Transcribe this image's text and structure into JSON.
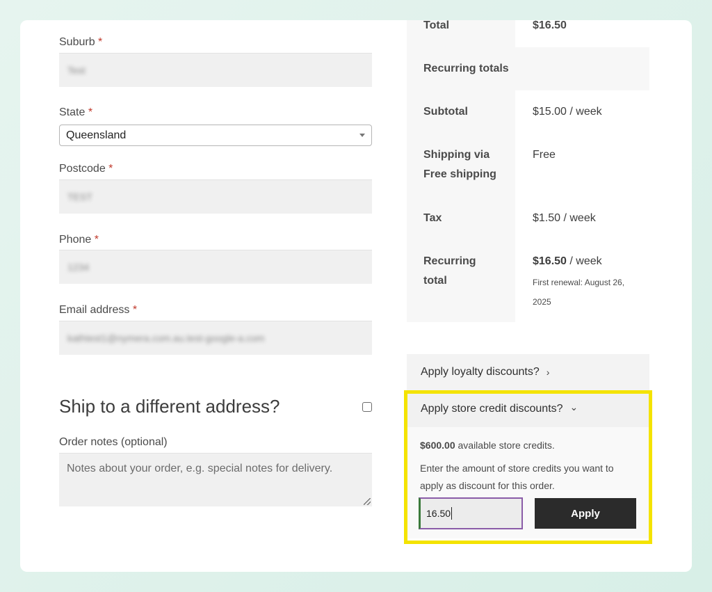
{
  "form": {
    "suburb": {
      "label": "Suburb",
      "required": "*",
      "value": "Test"
    },
    "state": {
      "label": "State",
      "required": "*",
      "value": "Queensland"
    },
    "postcode": {
      "label": "Postcode",
      "required": "*",
      "value": "TEST"
    },
    "phone": {
      "label": "Phone",
      "required": "*",
      "value": "1234"
    },
    "email": {
      "label": "Email address",
      "required": "*",
      "value": "kathtest1@nymera.com.au.test-google-a.com"
    },
    "ship_different": {
      "label": "Ship to a different address?"
    },
    "notes": {
      "label": "Order notes (optional)",
      "placeholder": "Notes about your order, e.g. special notes for delivery."
    }
  },
  "totals": {
    "total_label": "Total",
    "total_value": "$16.50",
    "recurring_heading": "Recurring totals",
    "subtotal_label": "Subtotal",
    "subtotal_value": "$15.00 / week",
    "shipping_label_1": "Shipping via",
    "shipping_label_2": "Free shipping",
    "shipping_value": "Free",
    "tax_label": "Tax",
    "tax_value": "$1.50 / week",
    "recurring_total_label_1": "Recurring",
    "recurring_total_label_2": "total",
    "recurring_total_amount": "$16.50",
    "recurring_total_period": " / week",
    "renewal_1": "First renewal: August 26,",
    "renewal_2": "2025"
  },
  "discounts": {
    "loyalty_label": "Apply loyalty discounts?",
    "loyalty_chevron": "›",
    "store_credit_label": "Apply store credit discounts?",
    "store_credit_chevron": "⌄",
    "available_amount": "$600.00",
    "available_suffix": " available store credits.",
    "instruction_1": "Enter the amount of store credits you want to",
    "instruction_2": "apply as discount for this order.",
    "input_value": "16.50",
    "apply_label": "Apply"
  },
  "colors": {
    "highlight": "#f4e300",
    "button": "#2b2b2b",
    "required": "#c0392b"
  }
}
